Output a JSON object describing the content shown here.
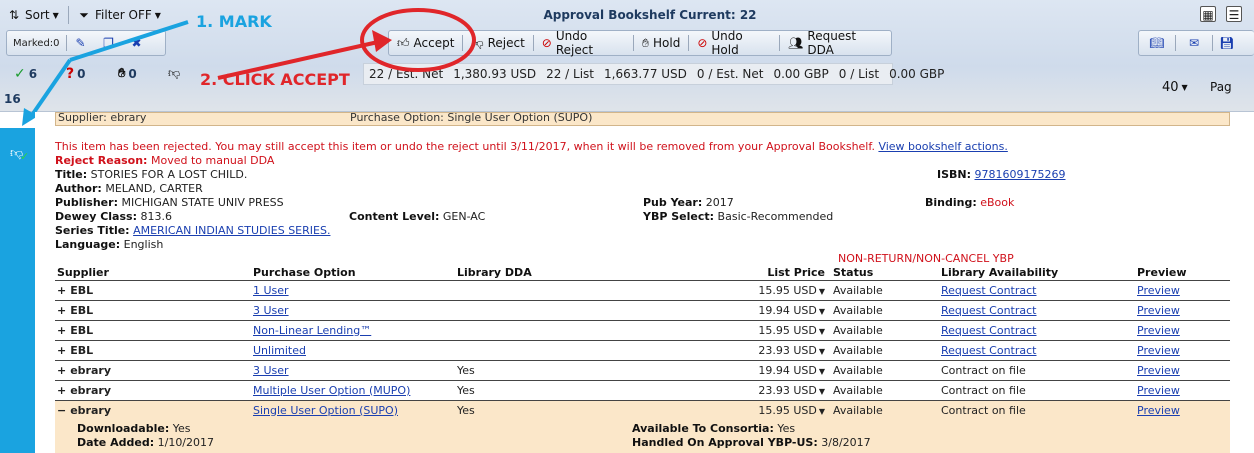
{
  "toolbar": {
    "sort_label": "Sort",
    "filter_label": "Filter OFF",
    "title": "Approval Bookshelf Current: 22",
    "marked_label": "Marked:0",
    "accept_label": "Accept",
    "reject_label": "Reject",
    "undo_reject_label": "Undo Reject",
    "hold_label": "Hold",
    "undo_hold_label": "Undo Hold",
    "request_dda_label": "Request DDA"
  },
  "counts": {
    "accepted": "6",
    "question": "0",
    "hold": "0",
    "total": "16"
  },
  "stats": {
    "s1": "22 / Est. Net",
    "s2": "1,380.93 USD",
    "s3": "22 / List",
    "s4": "1,663.77 USD",
    "s5": "0 / Est. Net",
    "s6": "0.00 GBP",
    "s7": "0 / List",
    "s8": "0.00 GBP"
  },
  "paging": {
    "per_page": "40",
    "page_label": "Pag"
  },
  "annotations": {
    "mark": "1. MARK",
    "click_accept": "2. CLICK ACCEPT"
  },
  "prev_row": {
    "supplier": "Supplier: ebrary",
    "option": "Purchase Option: Single User Option (SUPO)"
  },
  "item": {
    "notice": "This item has been rejected. You may still accept this item or undo the reject until 3/11/2017, when it will be removed from your Approval Bookshelf.",
    "notice_link": "View bookshelf actions.",
    "reject_reason_label": "Reject Reason:",
    "reject_reason": "Moved to manual DDA",
    "title_label": "Title:",
    "title": "STORIES FOR A LOST CHILD.",
    "author_label": "Author:",
    "author": "MELAND, CARTER",
    "publisher_label": "Publisher:",
    "publisher": "MICHIGAN STATE UNIV PRESS",
    "dewey_label": "Dewey Class:",
    "dewey": "813.6",
    "content_label": "Content Level:",
    "content": "GEN-AC",
    "series_label": "Series Title:",
    "series": "AMERICAN INDIAN STUDIES SERIES.",
    "language_label": "Language:",
    "language": "English",
    "pubyear_label": "Pub Year:",
    "pubyear": "2017",
    "ybp_label": "YBP Select:",
    "ybp": "Basic-Recommended",
    "isbn_label": "ISBN:",
    "isbn": "9781609175269",
    "binding_label": "Binding:",
    "binding": "eBook",
    "nonreturn": "NON-RETURN/NON-CANCEL YBP"
  },
  "table": {
    "headers": [
      "Supplier",
      "Purchase Option",
      "Library DDA",
      "List Price",
      "Status",
      "Library Availability",
      "Preview"
    ],
    "rows": [
      {
        "expand": "+",
        "supplier": "EBL",
        "option": "1 User",
        "dda": "",
        "price": "15.95 USD",
        "status": "Available",
        "avail": "Request Contract",
        "avail_link": true,
        "preview": "Preview"
      },
      {
        "expand": "+",
        "supplier": "EBL",
        "option": "3 User",
        "dda": "",
        "price": "19.94 USD",
        "status": "Available",
        "avail": "Request Contract",
        "avail_link": true,
        "preview": "Preview"
      },
      {
        "expand": "+",
        "supplier": "EBL",
        "option": "Non-Linear Lending™",
        "dda": "",
        "price": "15.95 USD",
        "status": "Available",
        "avail": "Request Contract",
        "avail_link": true,
        "preview": "Preview"
      },
      {
        "expand": "+",
        "supplier": "EBL",
        "option": "Unlimited",
        "dda": "",
        "price": "23.93 USD",
        "status": "Available",
        "avail": "Request Contract",
        "avail_link": true,
        "preview": "Preview"
      },
      {
        "expand": "+",
        "supplier": "ebrary",
        "option": "3 User",
        "dda": "Yes",
        "price": "19.94 USD",
        "status": "Available",
        "avail": "Contract on file",
        "avail_link": false,
        "preview": "Preview"
      },
      {
        "expand": "+",
        "supplier": "ebrary",
        "option": "Multiple User Option (MUPO)",
        "dda": "Yes",
        "price": "23.93 USD",
        "status": "Available",
        "avail": "Contract on file",
        "avail_link": false,
        "preview": "Preview"
      },
      {
        "expand": "−",
        "supplier": "ebrary",
        "option": "Single User Option (SUPO)",
        "dda": "Yes",
        "price": "15.95 USD",
        "status": "Available",
        "avail": "Contract on file",
        "avail_link": false,
        "preview": "Preview"
      }
    ]
  },
  "detail": {
    "downloadable_label": "Downloadable:",
    "downloadable": "Yes",
    "date_added_label": "Date Added:",
    "date_added": "1/10/2017",
    "consortia_label": "Available To Consortia:",
    "consortia": "Yes",
    "handled_label": "Handled On Approval YBP-US:",
    "handled": "3/8/2017"
  }
}
